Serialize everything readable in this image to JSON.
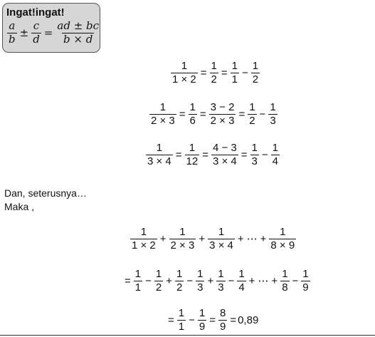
{
  "reminder": {
    "title": "Ingat!ingat!",
    "formula": {
      "a": "a",
      "b": "b",
      "pm": "±",
      "c": "c",
      "d": "d",
      "eq": "=",
      "num": "ad ± bc",
      "den": "b × d"
    }
  },
  "examples": [
    {
      "f1n": "1",
      "f1d": "1 × 2",
      "f2n": "1",
      "f2d": "2",
      "f3n": "1",
      "f3d": "1",
      "f4n": "1",
      "f4d": "2"
    },
    {
      "f1n": "1",
      "f1d": "2 × 3",
      "f2n": "1",
      "f2d": "6",
      "f3n": "3 − 2",
      "f3d": "2 × 3",
      "f4n": "1",
      "f4d": "2",
      "f5n": "1",
      "f5d": "3"
    },
    {
      "f1n": "1",
      "f1d": "3 × 4",
      "f2n": "1",
      "f2d": "12",
      "f3n": "4 − 3",
      "f3d": "3 × 4",
      "f4n": "1",
      "f4d": "3",
      "f5n": "1",
      "f5d": "4"
    }
  ],
  "ops": {
    "eq": "=",
    "minus": "−",
    "plus": "+",
    "dots": "⋯"
  },
  "text": {
    "line1": "Dan, seterusnya…",
    "line2": "Maka ,"
  },
  "sum_line": {
    "a_d": "1 × 2",
    "b_d": "2 × 3",
    "c_d": "3 × 4",
    "last_d": "8 × 9",
    "one": "1"
  },
  "telescope": {
    "terms": [
      "1",
      "2",
      "2",
      "3",
      "3",
      "4"
    ],
    "last": [
      "8",
      "9"
    ]
  },
  "result": {
    "a_d": "1",
    "b_d": "9",
    "r_n": "8",
    "r_d": "9",
    "value": "0,89"
  }
}
